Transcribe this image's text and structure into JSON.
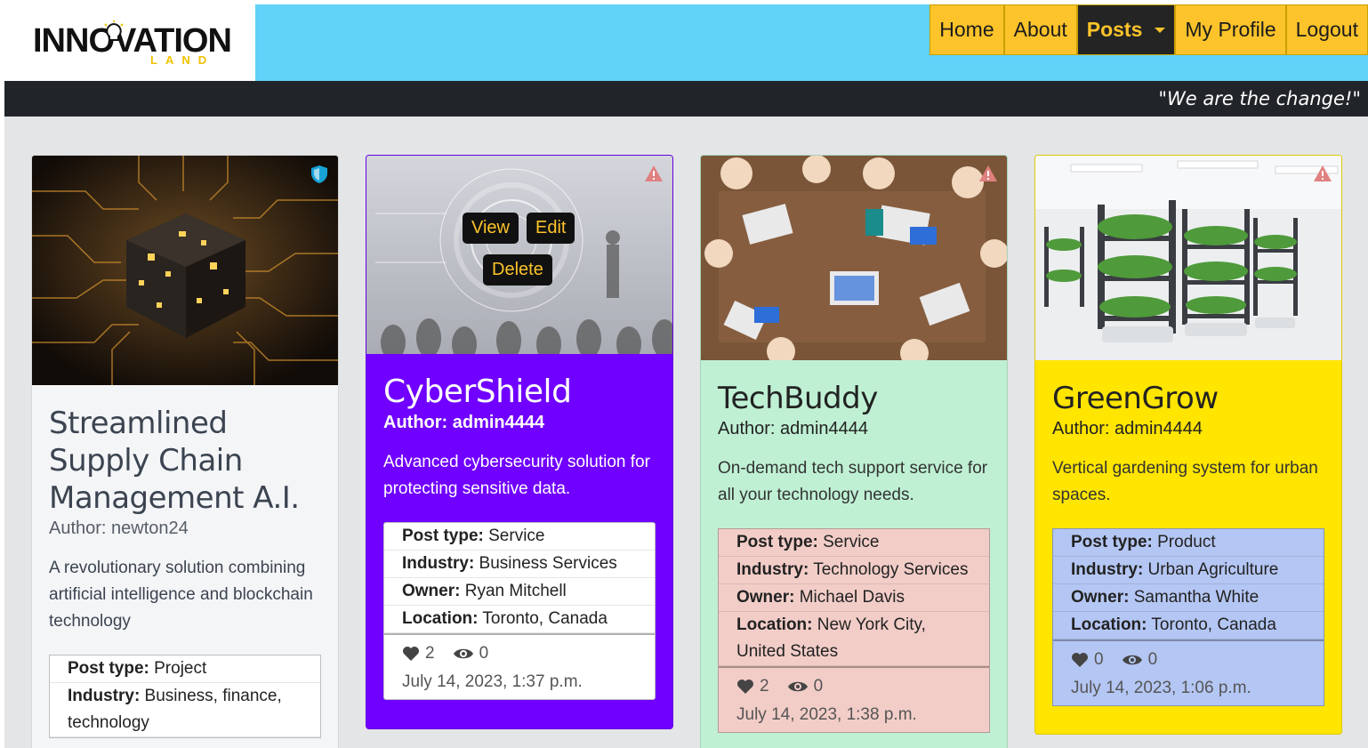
{
  "brand": {
    "name": "INNOVATION",
    "sub": "LAND"
  },
  "nav": {
    "items": [
      {
        "label": "Home"
      },
      {
        "label": "About"
      },
      {
        "label": "Posts"
      },
      {
        "label": "My Profile"
      },
      {
        "label": "Logout"
      }
    ]
  },
  "tagline": "\"We are the change!\"",
  "cards": [
    {
      "title": "Streamlined Supply Chain Management A.I.",
      "author": "Author: newton24",
      "description": "A revolutionary solution combining artificial intelligence and blockchain technology",
      "meta": [
        {
          "key": "Post type:",
          "value": " Project"
        },
        {
          "key": "Industry:",
          "value": " Business, finance, technology"
        }
      ],
      "badge_icon": "shield-icon"
    },
    {
      "title": "CyberShield",
      "author": "Author: admin4444",
      "description": "Advanced cybersecurity solution for protecting sensitive data.",
      "meta": [
        {
          "key": "Post type:",
          "value": " Service"
        },
        {
          "key": "Industry:",
          "value": " Business Services"
        },
        {
          "key": "Owner:",
          "value": " Ryan Mitchell"
        },
        {
          "key": "Location:",
          "value": " Toronto, Canada"
        }
      ],
      "likes": "2",
      "views": "0",
      "date": "July 14, 2023, 1:37 p.m.",
      "overlay": {
        "view": "View",
        "edit": "Edit",
        "delete": "Delete"
      },
      "badge_icon": "warning-icon"
    },
    {
      "title": "TechBuddy",
      "author": "Author: admin4444",
      "description": "On-demand tech support service for all your technology needs.",
      "meta": [
        {
          "key": "Post type:",
          "value": " Service"
        },
        {
          "key": "Industry:",
          "value": " Technology Services"
        },
        {
          "key": "Owner:",
          "value": " Michael Davis"
        },
        {
          "key": "Location:",
          "value": " New York City, United States"
        }
      ],
      "likes": "2",
      "views": "0",
      "date": "July 14, 2023, 1:38 p.m.",
      "badge_icon": "warning-icon"
    },
    {
      "title": "GreenGrow",
      "author": "Author: admin4444",
      "description": "Vertical gardening system for urban spaces.",
      "meta": [
        {
          "key": "Post type:",
          "value": " Product"
        },
        {
          "key": "Industry:",
          "value": " Urban Agriculture"
        },
        {
          "key": "Owner:",
          "value": " Samantha White"
        },
        {
          "key": "Location:",
          "value": " Toronto, Canada"
        }
      ],
      "likes": "0",
      "views": "0",
      "date": "July 14, 2023, 1:06 p.m.",
      "badge_icon": "warning-icon"
    }
  ],
  "colors": {
    "header": "#61d2f8",
    "nav": "#fcc32a",
    "card1": "#f4f5f7",
    "card2": "#7000ff",
    "card3": "#bff0d4",
    "card4": "#ffe500",
    "meta3": "#f2cdc8",
    "meta4": "#b4c6f3"
  }
}
